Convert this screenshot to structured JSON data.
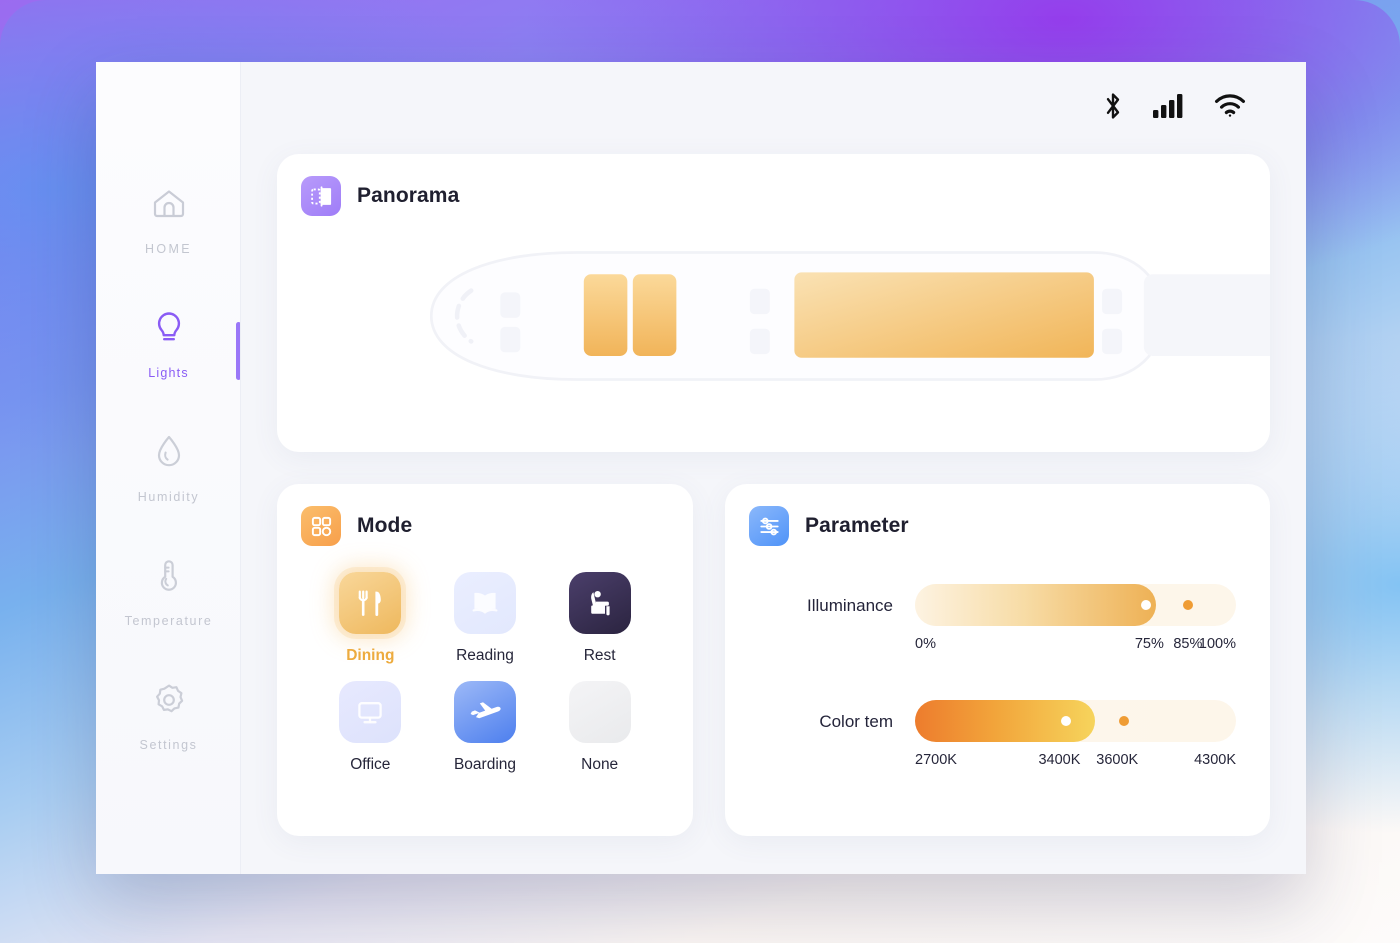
{
  "theme": {
    "accent_purple": "#8a5cf5",
    "accent_orange": "#edab3e",
    "accent_blue": "#4d7fee",
    "card_bg": "#ffffff",
    "app_bg": "#f5f6fa"
  },
  "statusbar": {
    "icons": [
      {
        "name": "bluetooth-icon",
        "label": "Bluetooth"
      },
      {
        "name": "cellular-signal-icon",
        "label": "Cellular signal",
        "bars": 4
      },
      {
        "name": "wifi-icon",
        "label": "Wi-Fi"
      }
    ]
  },
  "sidebar": {
    "items": [
      {
        "label": "HOME",
        "icon": "home-icon",
        "active": false
      },
      {
        "label": "Lights",
        "icon": "bulb-icon",
        "active": true
      },
      {
        "label": "Humidity",
        "icon": "droplet-icon",
        "active": false
      },
      {
        "label": "Temperature",
        "icon": "thermometer-icon",
        "active": false
      },
      {
        "label": "Settings",
        "icon": "gear-icon",
        "active": false
      }
    ]
  },
  "panorama": {
    "title": "Panorama",
    "icon": "panorama-icon",
    "zones": [
      {
        "name": "zone-1",
        "lit": true
      },
      {
        "name": "zone-2",
        "lit": true
      },
      {
        "name": "zone-3",
        "lit": true
      },
      {
        "name": "zone-4",
        "lit": false
      }
    ]
  },
  "mode": {
    "title": "Mode",
    "icon": "grid-icon",
    "selected": "Dining",
    "items": [
      {
        "label": "Dining",
        "icon": "cutlery-icon",
        "selected": true
      },
      {
        "label": "Reading",
        "icon": "book-icon",
        "selected": false
      },
      {
        "label": "Rest",
        "icon": "seat-icon",
        "selected": false
      },
      {
        "label": "Office",
        "icon": "monitor-icon",
        "selected": false
      },
      {
        "label": "Boarding",
        "icon": "airplane-icon",
        "selected": false
      },
      {
        "label": "None",
        "icon": "none-icon",
        "selected": false
      }
    ]
  },
  "parameter": {
    "title": "Parameter",
    "icon": "sliders-icon",
    "sliders": [
      {
        "label": "Illuminance",
        "fill_percent": 75,
        "primary_knob_percent": 72,
        "secondary_knob_percent": 85,
        "ticks": [
          {
            "text": "0%",
            "pos": 0
          },
          {
            "text": "75%",
            "pos": 73
          },
          {
            "text": "85%",
            "pos": 85
          },
          {
            "text": "100%",
            "pos": 100
          }
        ]
      },
      {
        "label": "Color tem",
        "fill_percent": 56,
        "primary_knob_percent": 47,
        "secondary_knob_percent": 65,
        "ticks": [
          {
            "text": "2700K",
            "pos": 0
          },
          {
            "text": "3400K",
            "pos": 45
          },
          {
            "text": "3600K",
            "pos": 63
          },
          {
            "text": "4300K",
            "pos": 100
          }
        ]
      }
    ]
  }
}
